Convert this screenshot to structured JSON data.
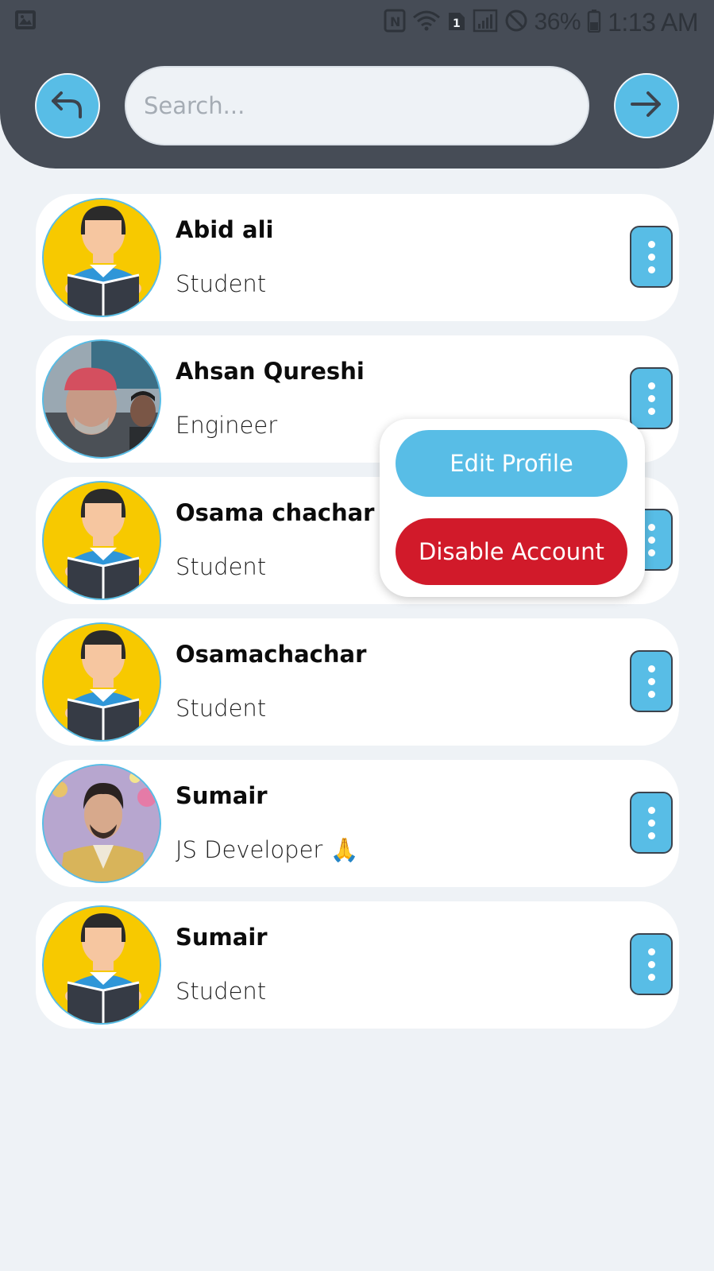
{
  "status_bar": {
    "time": "1:13 AM",
    "battery_percent": "36%",
    "sim_slot": "1",
    "icons": [
      "image-icon",
      "nfc-icon",
      "wifi-icon",
      "sim-icon",
      "signal-icon",
      "do-not-disturb-icon",
      "battery-icon"
    ]
  },
  "header": {
    "background": "#464c56",
    "accent": "#58bde6",
    "back_icon": "undo-arrow-icon",
    "forward_icon": "arrow-right-icon",
    "search": {
      "placeholder": "Search...",
      "value": ""
    }
  },
  "users": [
    {
      "name": "Abid ali",
      "role": "Student",
      "avatar": "student-avatar"
    },
    {
      "name": "Ahsan Qureshi",
      "role": "Engineer",
      "avatar": "photo-avatar"
    },
    {
      "name": "Osama chachar",
      "role": "Student",
      "avatar": "student-avatar"
    },
    {
      "name": "Osamachachar",
      "role": "Student",
      "avatar": "student-avatar"
    },
    {
      "name": "Sumair",
      "role": "JS Developer 🙏",
      "avatar": "photo-avatar"
    },
    {
      "name": "Sumair",
      "role": "Student",
      "avatar": "student-avatar"
    }
  ],
  "popup_menu": {
    "edit_label": "Edit Profile",
    "disable_label": "Disable Account",
    "edit_color": "#58bde6",
    "disable_color": "#d11a2a"
  }
}
